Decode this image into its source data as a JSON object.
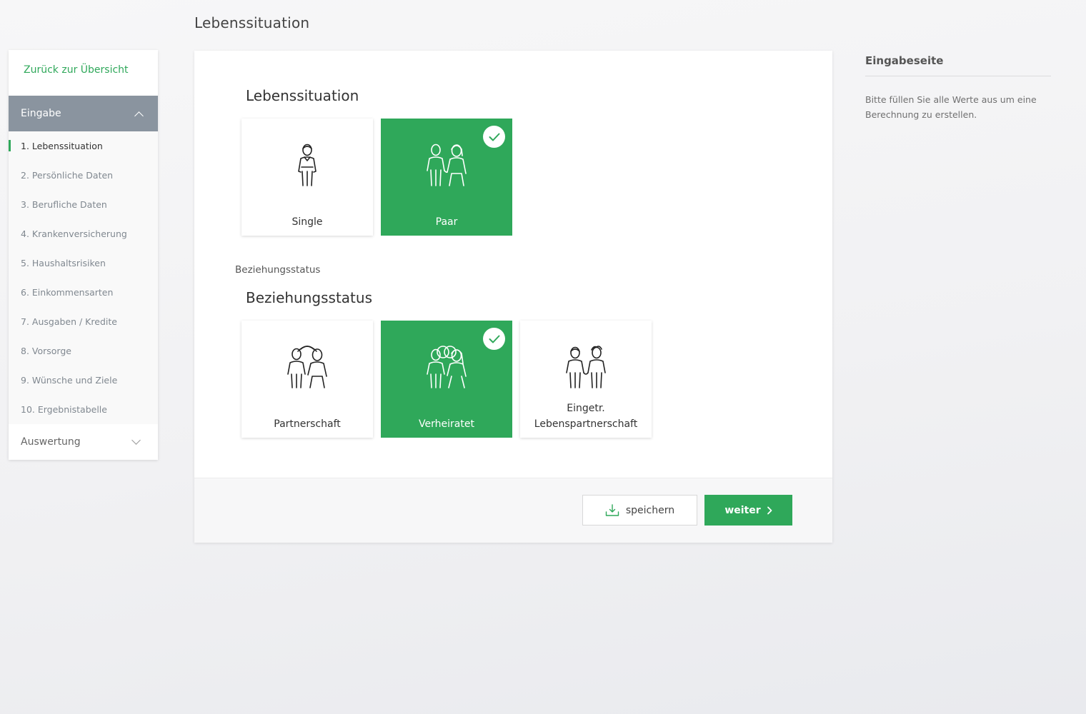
{
  "page": {
    "title": "Lebenssituation"
  },
  "sidebar": {
    "back_label": "Zurück zur Übersicht",
    "section_open": "Eingabe",
    "items": [
      {
        "label": "1. Lebenssituation",
        "active": true
      },
      {
        "label": "2. Persönliche Daten"
      },
      {
        "label": "3. Berufliche Daten"
      },
      {
        "label": "4. Krankenversicherung"
      },
      {
        "label": "5. Haushaltsrisiken"
      },
      {
        "label": "6. Einkommensarten"
      },
      {
        "label": "7. Ausgaben / Kredite"
      },
      {
        "label": "8. Vorsorge"
      },
      {
        "label": "9. Wünsche und Ziele"
      },
      {
        "label": "10. Ergebnistabelle"
      }
    ],
    "section_closed": "Auswertung"
  },
  "main": {
    "situation": {
      "heading": "Lebenssituation",
      "options": [
        {
          "label": "Single",
          "selected": false,
          "icon": "single-person-icon"
        },
        {
          "label": "Paar",
          "selected": true,
          "icon": "couple-icon"
        }
      ]
    },
    "relationship": {
      "small_label": "Beziehungsstatus",
      "heading": "Beziehungsstatus",
      "options": [
        {
          "label": "Partnerschaft",
          "selected": false,
          "icon": "partnership-icon"
        },
        {
          "label": "Verheiratet",
          "selected": true,
          "icon": "married-icon"
        },
        {
          "label": "Eingetr. Lebenspartnerschaft",
          "label_line1": "Eingetr.",
          "label_line2": "Lebenspartnerschaft",
          "selected": false,
          "icon": "registered-partnership-icon"
        }
      ]
    },
    "footer": {
      "save_label": "speichern",
      "next_label": "weiter"
    }
  },
  "info": {
    "title": "Eingabeseite",
    "text": "Bitte füllen Sie alle Werte aus um eine Berechnung zu erstellen."
  },
  "colors": {
    "accent": "#2fa85a",
    "sidebar_section": "#8a949f"
  }
}
